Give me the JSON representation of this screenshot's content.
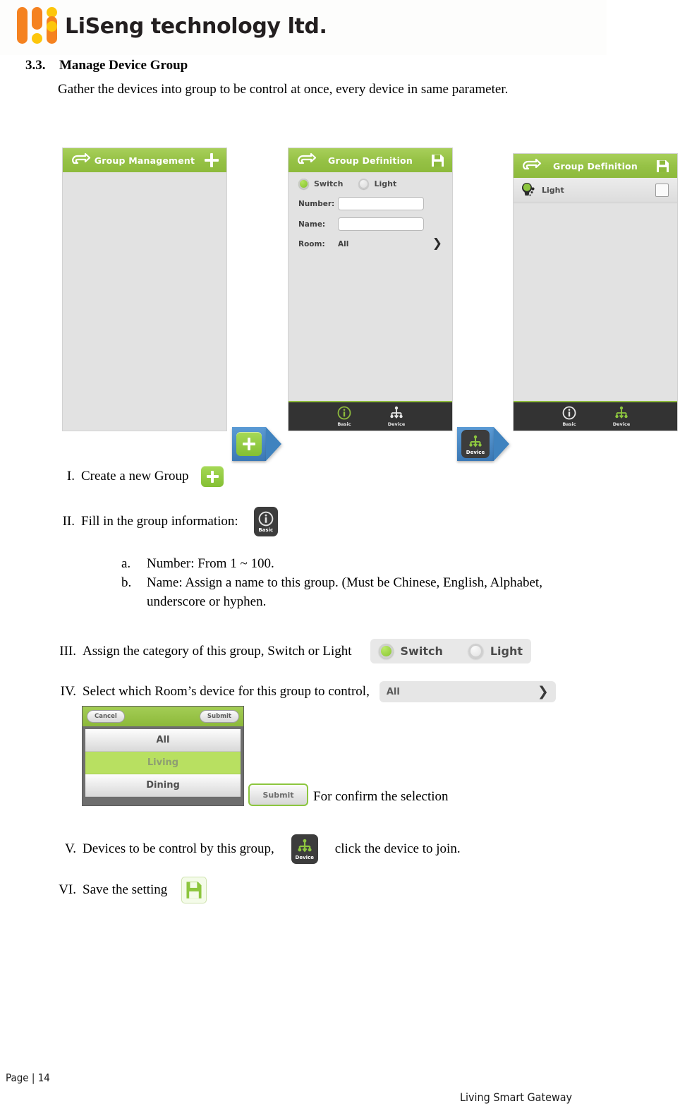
{
  "brand": {
    "name": "LiSeng technology ltd.",
    "logo_colors": [
      "#F58220",
      "#FBAF17",
      "#FDC60B"
    ]
  },
  "section": {
    "number": "3.3.",
    "title": "Manage Device Group",
    "body": "Gather the devices into group to be control at once, every device in same parameter."
  },
  "screens": [
    {
      "name": "group-management",
      "title": "Group Management",
      "back_icon": "back-arrow-icon",
      "action_icon": "plus-icon"
    },
    {
      "name": "group-definition-basic",
      "title": "Group Definition",
      "back_icon": "back-arrow-icon",
      "action_icon": "save-icon",
      "category": {
        "selected": "Switch",
        "options": [
          "Switch",
          "Light"
        ]
      },
      "fields": [
        {
          "label": "Number:",
          "value": "",
          "type": "text"
        },
        {
          "label": "Name:",
          "value": "",
          "type": "text"
        },
        {
          "label": "Room:",
          "value": "All",
          "type": "chooser",
          "chevron": "❯"
        }
      ],
      "tabs": [
        {
          "label": "Basic",
          "icon": "info-icon",
          "active": true
        },
        {
          "label": "Device",
          "icon": "device-tree-icon",
          "active": false
        }
      ]
    },
    {
      "name": "group-definition-device",
      "title": "Group Definition",
      "back_icon": "back-arrow-icon",
      "action_icon": "save-icon",
      "device_rows": [
        {
          "name": "Light",
          "icon": "light-bulb-icon",
          "checked": false
        }
      ],
      "tabs": [
        {
          "label": "Basic",
          "icon": "info-icon",
          "active": false
        },
        {
          "label": "Device",
          "icon": "device-tree-icon",
          "active": true
        }
      ]
    }
  ],
  "callouts": [
    {
      "name": "add-group-callout",
      "icon": "plus-button-icon",
      "label": ""
    },
    {
      "name": "device-tab-callout",
      "icon": "device-tree-icon",
      "label": "Device"
    }
  ],
  "steps": [
    {
      "numeral": "I.",
      "text": "Create a new Group",
      "icon": "plus-button-icon"
    },
    {
      "numeral": "II.",
      "text": "Fill in the group information:",
      "icon": "basic-tab-icon",
      "icon_label": "Basic"
    },
    {
      "numeral": "III.",
      "text": "Assign the category of this group, Switch or Light",
      "widget": "switch-light-radio"
    },
    {
      "numeral": "IV.",
      "text": "Select which Room’s device for this group to control,",
      "widget": "room-chooser"
    },
    {
      "numeral": "V.",
      "text_before": "Devices to be control by this group,",
      "text_after": "click the device to join.",
      "icon": "device-tab-icon",
      "icon_label": "Device"
    },
    {
      "numeral": "VI.",
      "text": "Save the setting",
      "icon": "save-icon"
    }
  ],
  "substeps": [
    {
      "marker": "a.",
      "text": "Number: From 1 ~ 100."
    },
    {
      "marker": "b.",
      "text": "Name:    Assign a name to this group. (Must be Chinese, English, Alphabet, underscore or hyphen."
    }
  ],
  "category_widget": {
    "selected": "Switch",
    "options": [
      {
        "label": "Switch",
        "on": true
      },
      {
        "label": "Light",
        "on": false
      }
    ]
  },
  "room_widget": {
    "value": "All",
    "chevron": "❯"
  },
  "room_picker": {
    "cancel_label": "Cancel",
    "submit_label": "Submit",
    "items": [
      {
        "label": "All",
        "selected": false
      },
      {
        "label": "Living",
        "selected": true
      },
      {
        "label": "Dining",
        "selected": false
      }
    ]
  },
  "submit_button": {
    "label": "Submit",
    "note": "For confirm the selection"
  },
  "footer": {
    "page": "Page | 14",
    "product": "Living Smart Gateway"
  }
}
